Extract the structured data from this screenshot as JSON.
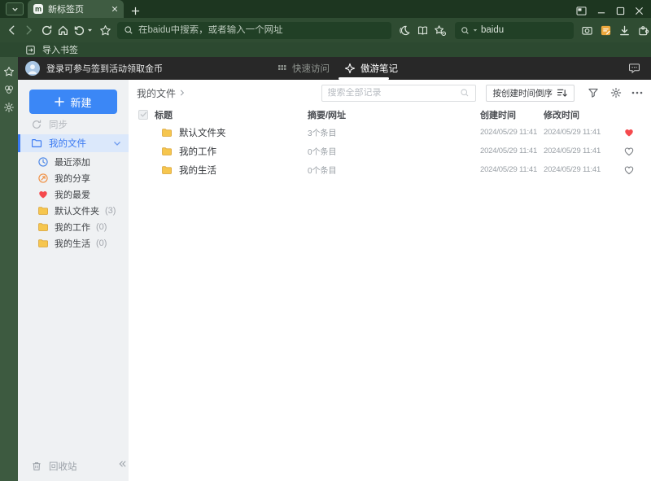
{
  "browser": {
    "logo_glyph": "m",
    "tab_title": "新标签页",
    "address_placeholder": "在baidu中搜索，或者输入一个网址",
    "search_value": "baidu",
    "import_bookmarks_label": "导入书签"
  },
  "appheader": {
    "login_text": "登录可参与签到活动领取金币",
    "tabs": [
      {
        "label": "快速访问"
      },
      {
        "label": "傲游笔记"
      }
    ]
  },
  "sidebar": {
    "new_label": "新建",
    "sync_label": "同步",
    "my_files_label": "我的文件",
    "items": [
      {
        "icon": "clock",
        "label": "最近添加",
        "count": ""
      },
      {
        "icon": "share",
        "label": "我的分享",
        "count": ""
      },
      {
        "icon": "heart",
        "label": "我的最爱",
        "count": ""
      },
      {
        "icon": "folder",
        "label": "默认文件夹",
        "count": "(3)"
      },
      {
        "icon": "folder",
        "label": "我的工作",
        "count": "(0)"
      },
      {
        "icon": "folder",
        "label": "我的生活",
        "count": "(0)"
      }
    ],
    "recycle_label": "回收站"
  },
  "content": {
    "breadcrumb": "我的文件",
    "search_placeholder": "搜索全部记录",
    "sort_label": "按创建时间倒序",
    "table": {
      "headers": [
        "标题",
        "摘要/网址",
        "创建时间",
        "修改时间"
      ],
      "rows": [
        {
          "title": "默认文件夹",
          "summary": "3个条目",
          "created": "2024/05/29 11:41",
          "modified": "2024/05/29 11:41",
          "favorite": true
        },
        {
          "title": "我的工作",
          "summary": "0个条目",
          "created": "2024/05/29 11:41",
          "modified": "2024/05/29 11:41",
          "favorite": false
        },
        {
          "title": "我的生活",
          "summary": "0个条目",
          "created": "2024/05/29 11:41",
          "modified": "2024/05/29 11:41",
          "favorite": false
        }
      ]
    }
  },
  "colors": {
    "accent": "#3b7af2",
    "button_blue": "#3b87f6",
    "favorite_red": "#f5494d",
    "folder_yellow": "#f6c64e",
    "folder_stroke": "#dca73a",
    "share_orange": "#f08f42",
    "clock_blue": "#4a86e8",
    "browser_green_dark": "#1d3620",
    "browser_green": "#2f4c32"
  }
}
